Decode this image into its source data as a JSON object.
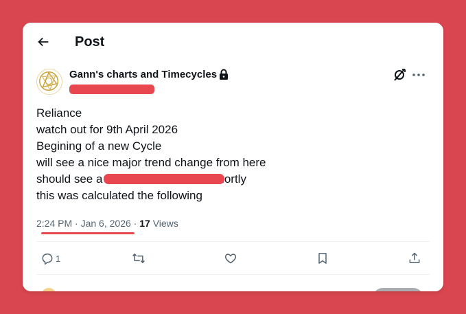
{
  "header": {
    "back_icon": "arrow-left-icon",
    "title": "Post"
  },
  "author": {
    "name": "Gann's charts and Timecycles",
    "badge_icon": "lock-icon",
    "avatar_icon": "gold-geometric-logo"
  },
  "post": {
    "lines": [
      "Reliance",
      "watch out for 9th April 2026",
      "Begining of a new Cycle",
      "will see a nice major trend change from here",
      "should see a",
      "this was calculated the following"
    ],
    "line5_tail": "shortly"
  },
  "meta": {
    "time": "2:24 PM",
    "date": "Jan 6, 2026",
    "views_count": "17",
    "views_label": "Views"
  },
  "actions": {
    "reply_count": "1",
    "reply_icon": "reply-icon",
    "repost_icon": "repost-icon",
    "like_icon": "heart-icon",
    "bookmark_icon": "bookmark-icon",
    "share_icon": "share-icon"
  },
  "colors": {
    "background": "#d9464f",
    "redaction": "#e8474f",
    "text_primary": "#0f1419",
    "text_secondary": "#536471"
  }
}
